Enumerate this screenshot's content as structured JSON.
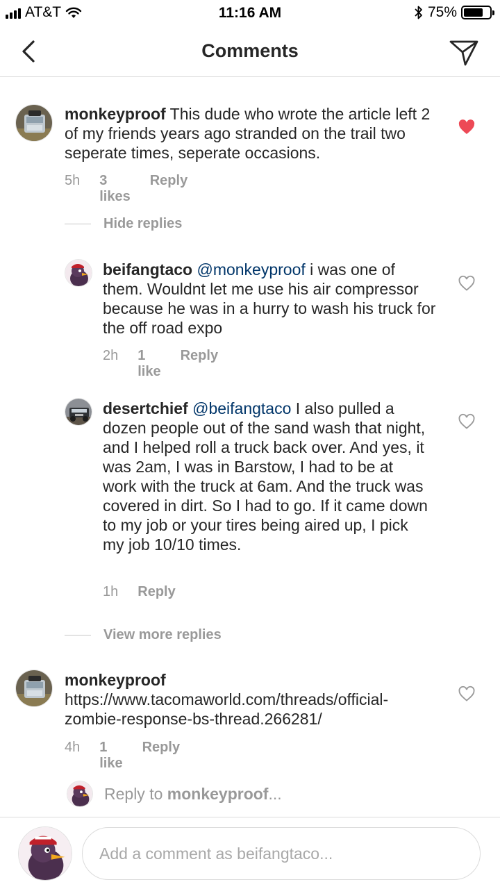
{
  "status_bar": {
    "carrier": "AT&T",
    "time": "11:16 AM",
    "battery": "75%",
    "battery_level": 0.75
  },
  "header": {
    "title": "Comments",
    "back_icon": "chevron-left-icon",
    "send_icon": "paper-plane-icon"
  },
  "comments": [
    {
      "username": "monkeyproof",
      "text": "This dude who wrote the article left 2 of my friends years ago stranded on the trail two seperate times, seperate occasions.",
      "time": "5h",
      "likes": "3 likes",
      "reply": "Reply",
      "liked": true
    },
    {
      "username": "beifangtaco",
      "mention": "@monkeyproof",
      "text": "i was one of them. Wouldnt let me use his air compressor because he was in a hurry to wash his truck for the off road expo",
      "time": "2h",
      "likes": "1 like",
      "reply": "Reply",
      "liked": false
    },
    {
      "username": "desertchief",
      "mention": "@beifangtaco",
      "text": "I also pulled a dozen people out of the sand wash that night, and I helped roll a truck back over. And yes, it was 2am, I was in Barstow, I had to be at work with the truck at 6am. And the truck was covered in dirt. So I had to go. If it came down to my job or your tires being aired up, I pick my job 10/10 times.",
      "time": "1h",
      "reply": "Reply",
      "liked": false
    },
    {
      "username": "monkeyproof",
      "text": "https://www.tacomaworld.com/threads/official-zombie-response-bs-thread.266281/",
      "time": "4h",
      "likes": "1 like",
      "reply": "Reply",
      "liked": false
    }
  ],
  "hide_replies": "Hide replies",
  "view_more_replies": "View more replies",
  "reply_to": {
    "prefix": "Reply to",
    "username": "monkeyproof",
    "suffix": "..."
  },
  "composer": {
    "placeholder": "Add a comment as beifangtaco..."
  },
  "colors": {
    "heart_liked": "#ed4956",
    "mention": "#003569",
    "meta": "#999999"
  }
}
